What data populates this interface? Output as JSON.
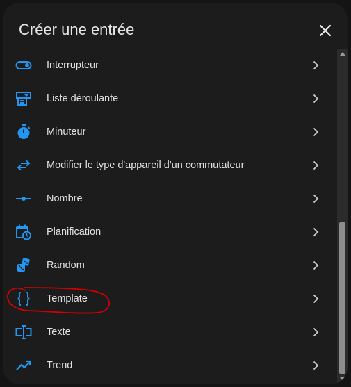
{
  "dialog": {
    "title": "Créer une entrée",
    "close_icon": "close-icon"
  },
  "colors": {
    "accent": "#2196f3",
    "background": "#1c1c1c",
    "text": "#e1e1e1",
    "annotation": "#d40000"
  },
  "items": [
    {
      "label": "Interrupteur",
      "icon": "toggle-switch-icon"
    },
    {
      "label": "Liste déroulante",
      "icon": "form-dropdown-icon"
    },
    {
      "label": "Minuteur",
      "icon": "timer-icon"
    },
    {
      "label": "Modifier le type d'appareil d'un commutateur",
      "icon": "swap-arrows-icon"
    },
    {
      "label": "Nombre",
      "icon": "ray-vertex-icon"
    },
    {
      "label": "Planification",
      "icon": "calendar-clock-icon"
    },
    {
      "label": "Random",
      "icon": "dice-icon"
    },
    {
      "label": "Template",
      "icon": "code-braces-icon"
    },
    {
      "label": "Texte",
      "icon": "form-textbox-icon"
    },
    {
      "label": "Trend",
      "icon": "trending-up-icon"
    }
  ]
}
